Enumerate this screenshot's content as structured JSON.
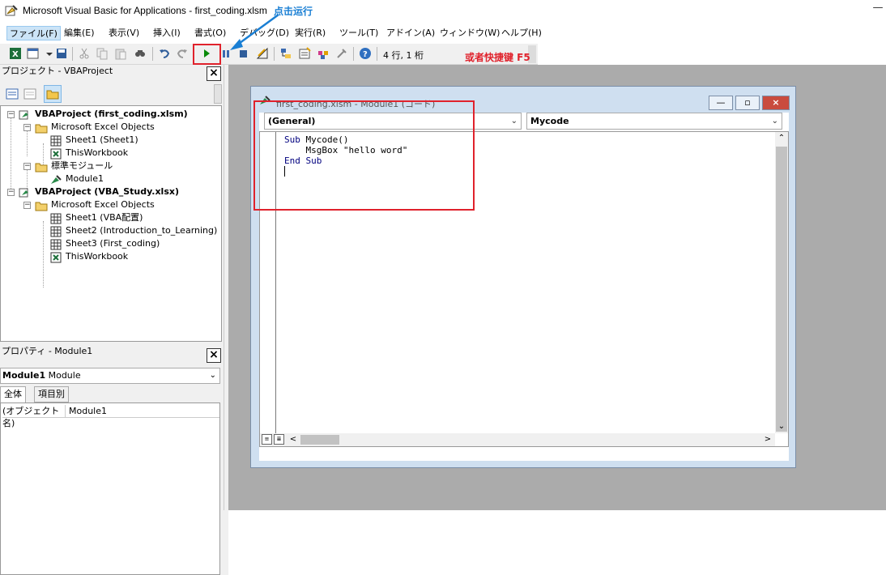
{
  "window": {
    "title": "Microsoft Visual Basic for Applications - first_coding.xlsm",
    "minimize_glyph": "—"
  },
  "menu": [
    {
      "label": "ファイル(F)"
    },
    {
      "label": "編集(E)"
    },
    {
      "label": "表示(V)"
    },
    {
      "label": "挿入(I)"
    },
    {
      "label": "書式(O)"
    },
    {
      "label": "デバッグ(D)"
    },
    {
      "label": "実行(R)"
    },
    {
      "label": "ツール(T)"
    },
    {
      "label": "アドイン(A)"
    },
    {
      "label": "ウィンドウ(W)"
    },
    {
      "label": "ヘルプ(H)"
    }
  ],
  "toolbar": {
    "position_text": "4 行, 1 桁",
    "icons": [
      "excel-icon",
      "insert-userform-icon",
      "save-icon",
      "cut-icon",
      "copy-icon",
      "paste-icon",
      "find-icon",
      "undo-icon",
      "redo-icon",
      "run-icon",
      "break-icon",
      "reset-icon",
      "design-mode-icon",
      "project-explorer-icon",
      "properties-icon",
      "object-browser-icon",
      "toolbox-icon",
      "help-icon"
    ],
    "run_color": "#0a8a0a"
  },
  "project_panel": {
    "title": "プロジェクト - VBAProject",
    "close": "×",
    "tree": [
      {
        "label": "VBAProject (first_coding.xlsm)",
        "bold": true
      },
      {
        "label": "Microsoft Excel Objects"
      },
      {
        "label": "Sheet1 (Sheet1)"
      },
      {
        "label": "ThisWorkbook"
      },
      {
        "label": "標準モジュール"
      },
      {
        "label": "Module1"
      },
      {
        "label": "VBAProject (VBA_Study.xlsx)",
        "bold": true
      },
      {
        "label": "Microsoft Excel Objects"
      },
      {
        "label": "Sheet1 (VBA配置)"
      },
      {
        "label": "Sheet2 (Introduction_to_Learning)"
      },
      {
        "label": "Sheet3 (First_coding)"
      },
      {
        "label": "ThisWorkbook"
      }
    ]
  },
  "properties_panel": {
    "title": "プロパティ - Module1",
    "close": "×",
    "object_name": "Module1",
    "object_type": "Module",
    "tabs": [
      {
        "label": "全体"
      },
      {
        "label": "項目別"
      }
    ],
    "row_name": "(オブジェクト名)",
    "row_value": "Module1"
  },
  "code_window": {
    "title": "first_coding.xlsm - Module1 (コード)",
    "object_combo": "(General)",
    "proc_combo": "Mycode",
    "code": {
      "line1_kw": "Sub",
      "line1_rest": " Mycode()",
      "line2": "    MsgBox \"hello word\"",
      "line3": "End Sub"
    },
    "buttons": {
      "min": "—",
      "restore": "▫",
      "close": "×"
    }
  },
  "annotations": {
    "click_run": "点击运行",
    "shortcut": "或者快捷键 F5",
    "red": "#e0222c",
    "blue": "#1a7fd4"
  }
}
